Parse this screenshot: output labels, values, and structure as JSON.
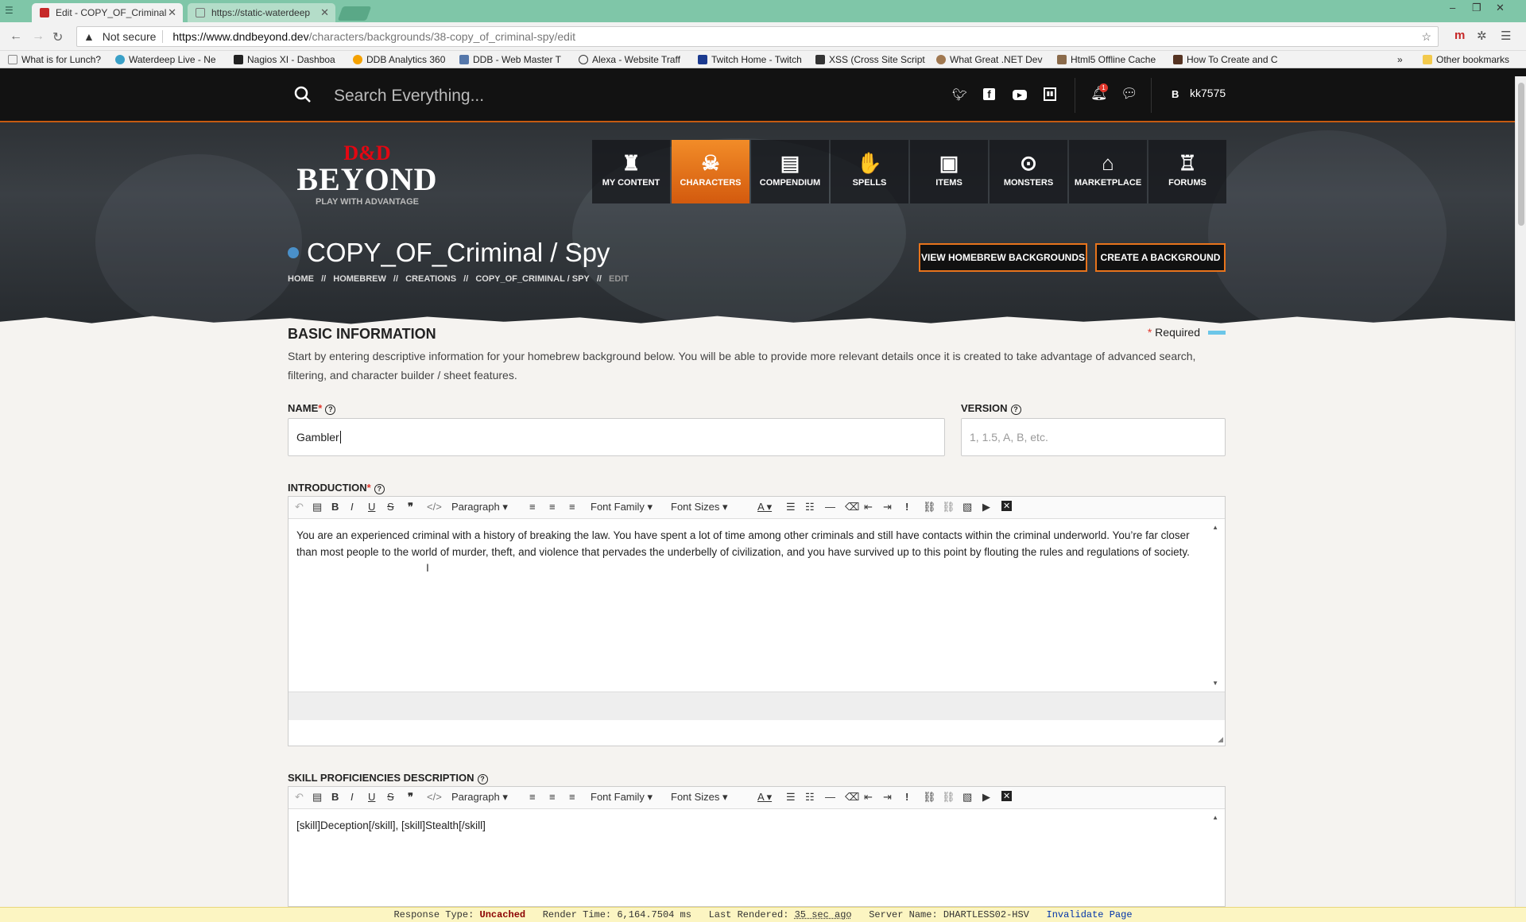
{
  "browser": {
    "tabs": [
      {
        "title": "Edit - COPY_OF_Criminal",
        "active": true
      },
      {
        "title": "https://static-waterdeep",
        "active": false
      }
    ],
    "address": {
      "security": "Not secure",
      "host": "https://www.dndbeyond.dev",
      "path": "/characters/backgrounds/38-copy_of_criminal-spy/edit"
    },
    "bookmarks": [
      "What is for Lunch?",
      "Waterdeep Live - Ne",
      "Nagios XI - Dashboa",
      "DDB Analytics 360",
      "DDB - Web Master T",
      "Alexa - Website Traff",
      "Twitch Home - Twitch",
      "XSS (Cross Site Script",
      "What Great .NET Dev",
      "Html5 Offline Cache",
      "How To Create and C"
    ],
    "bookmarks_more": "»",
    "other_bookmarks": "Other bookmarks"
  },
  "site": {
    "search_placeholder": "Search Everything...",
    "notification_count": "1",
    "avatar_letter": "B",
    "username": "kk7575",
    "logo_top": "D&D",
    "logo_main": "BEYOND",
    "logo_tag": "PLAY WITH ADVANTAGE",
    "nav": [
      {
        "label": "MY CONTENT",
        "icon": "♜"
      },
      {
        "label": "CHARACTERS",
        "icon": "☠"
      },
      {
        "label": "COMPENDIUM",
        "icon": "▤"
      },
      {
        "label": "SPELLS",
        "icon": "✋"
      },
      {
        "label": "ITEMS",
        "icon": "▣"
      },
      {
        "label": "MONSTERS",
        "icon": "⊙"
      },
      {
        "label": "MARKETPLACE",
        "icon": "⌂"
      },
      {
        "label": "FORUMS",
        "icon": "♖"
      }
    ],
    "active_nav": "CHARACTERS"
  },
  "page": {
    "title": "COPY_OF_Criminal / Spy",
    "breadcrumbs": [
      "HOME",
      "//",
      "HOMEBREW",
      "//",
      "CREATIONS",
      "//",
      "COPY_OF_CRIMINAL / SPY",
      "//",
      "EDIT"
    ],
    "view_button": "VIEW HOMEBREW BACKGROUNDS",
    "create_button": "CREATE A BACKGROUND"
  },
  "form": {
    "section_title": "BASIC INFORMATION",
    "required_label": "Required",
    "required_star": "*",
    "description": "Start by entering descriptive information for your homebrew background below. You will be able to provide more relevant details once it is created to take advantage of advanced search, filtering, and character builder / sheet features.",
    "name_label": "NAME",
    "name_value": "Gambler",
    "version_label": "VERSION",
    "version_placeholder": "1, 1.5, A, B, etc.",
    "intro_label": "INTRODUCTION",
    "intro_text": "You are an experienced criminal with a history of breaking the law. You have spent a lot of time among other criminals and still have contacts within the criminal underworld. You’re far closer than most people to the world of murder, theft, and violence that pervades the underbelly of civilization, and you have survived up to this point by flouting the rules and regulations of society.",
    "skill_label": "SKILL PROFICIENCIES DESCRIPTION",
    "skill_text": "[skill]Deception[/skill], [skill]Stealth[/skill]",
    "toolbar": {
      "paragraph": "Paragraph",
      "font_family": "Font Family",
      "font_sizes": "Font Sizes"
    }
  },
  "debug": {
    "response_type_label": "Response Type:",
    "response_type": "Uncached",
    "render_time_label": "Render Time:",
    "render_time": "6,164.7504 ms",
    "last_rendered_label": "Last Rendered:",
    "last_rendered": "35 sec ago",
    "server_name_label": "Server Name:",
    "server_name": "DHARTLESS02-HSV",
    "invalidate": "Invalidate Page"
  },
  "colors": {
    "accent": "#e8741c",
    "active_nav": "#f28c28",
    "brand_red": "#e40712"
  }
}
